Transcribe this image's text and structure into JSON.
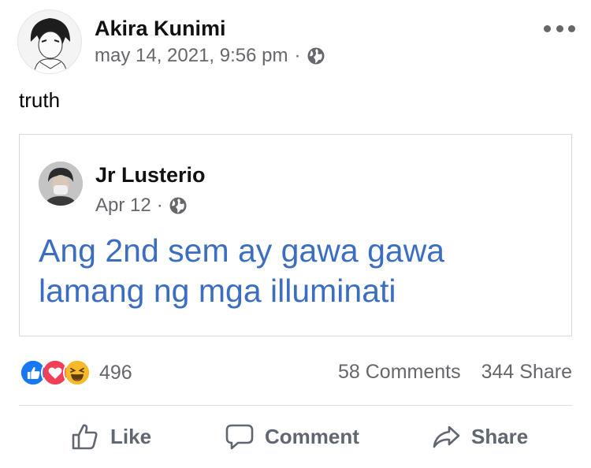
{
  "post": {
    "author": "Akira Kunimi",
    "timestamp": "may 14, 2021, 9:56 pm",
    "separator": "·",
    "privacy_icon": "globe-icon",
    "text": "truth",
    "more_icon": "more-options-icon"
  },
  "shared": {
    "author": "Jr Lusterio",
    "timestamp": "Apr 12",
    "separator": "·",
    "privacy_icon": "globe-icon",
    "text": "Ang 2nd sem ay gawa gawa lamang ng mga illuminati",
    "text_color": "#3b6ec3"
  },
  "reactions": {
    "icons": [
      "like-reaction-icon",
      "love-reaction-icon",
      "haha-reaction-icon"
    ],
    "count": "496",
    "comments": "58 Comments",
    "shares": "344 Share"
  },
  "actions": {
    "like": "Like",
    "comment": "Comment",
    "share": "Share"
  },
  "colors": {
    "like_blue": "#1877f2",
    "love_red": "#f33e58",
    "haha_yellow": "#f7b928",
    "secondary_text": "#65676b"
  }
}
